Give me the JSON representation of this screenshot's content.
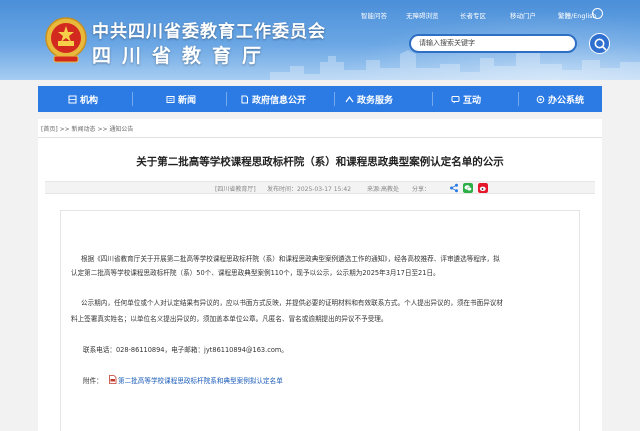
{
  "header": {
    "org_name": "中共四川省委教育工作委员会",
    "dept_name": "四川省教育厅",
    "top_links": [
      "智能问答",
      "无障碍浏览",
      "长者专区",
      "移动门户",
      "繁體/English"
    ],
    "search_placeholder": "请输入搜索关键字"
  },
  "nav": {
    "items": [
      {
        "label": "机构",
        "icon": "building-icon"
      },
      {
        "label": "新闻",
        "icon": "newspaper-icon"
      },
      {
        "label": "政府信息公开",
        "icon": "document-icon"
      },
      {
        "label": "政务服务",
        "icon": "service-icon"
      },
      {
        "label": "互动",
        "icon": "chat-icon"
      },
      {
        "label": "办公系统",
        "icon": "system-icon"
      }
    ]
  },
  "breadcrumb": "[首页] >> 新闻动态 >> 通知公告",
  "article": {
    "title": "关于第二批高等学校课程思政标杆院（系）和课程思政典型案例认定名单的公示",
    "meta": {
      "channel": "[四川省教育厅]",
      "publish_time": "发布时间：2025-03-17 15:42",
      "source": "来源:高教处",
      "share_label": "分享："
    },
    "paragraphs": [
      "根据《四川省教育厅关于开展第二批高等学校课程思政标杆院（系）和课程思政典型案例遴选工作的通知》，经各高校推荐、评审遴选等程序，拟",
      "认定第二批高等学校课程思政标杆院（系）50个、课程思政典型案例110个，现予以公示，公示期为2025年3月17日至21日。",
      "公示期内，任何单位或个人对认定结果有异议的，应以书面方式反映，并提供必要的证明材料和有效联系方式。个人提出异议的，须在书面异议材",
      "料上签署真实姓名；以单位名义提出异议的，须加盖本单位公章。凡匿名、冒名或逾期提出的异议不予受理。",
      "联系电话：028-86110894，电子邮箱：jyt86110894@163.com。"
    ],
    "attachment_label": "附件：",
    "attachment_link": "第二批高等学校课程思政标杆院系和典型案例拟认定名单"
  },
  "colors": {
    "nav_blue": "#2c7be5",
    "header_blue": "#4b8fd9",
    "link_blue": "#1a5cb8"
  }
}
